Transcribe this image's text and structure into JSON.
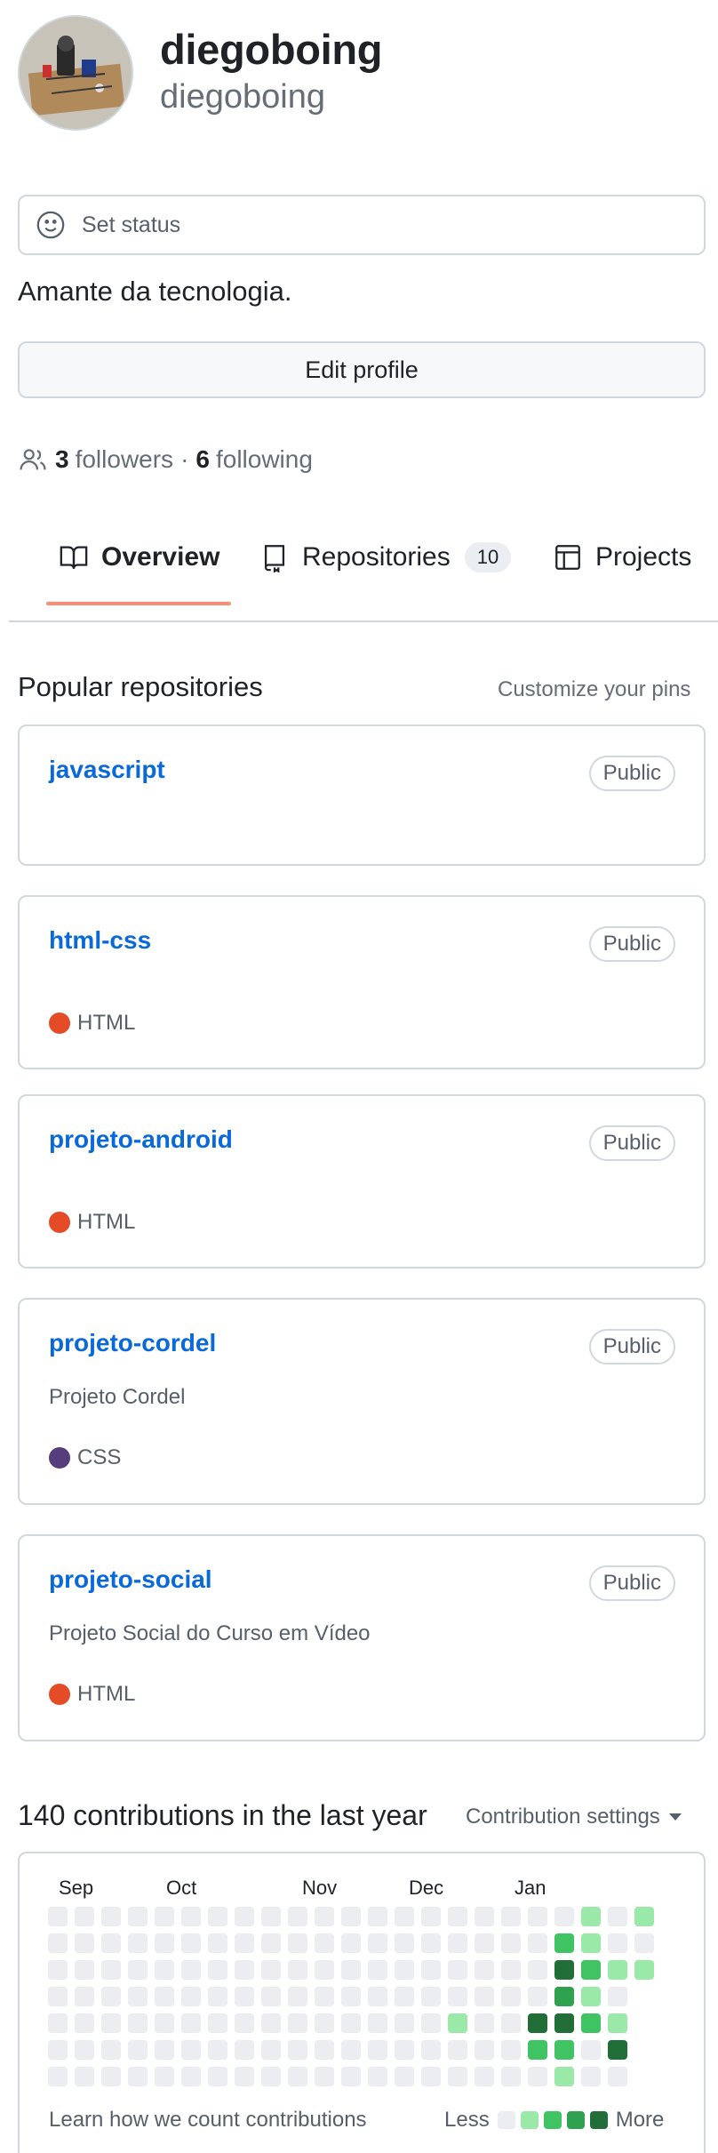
{
  "profile": {
    "display_name": "diegoboing",
    "login": "diegoboing",
    "avatar_alt": "avatar"
  },
  "status": {
    "placeholder": "Set status",
    "icon": "smiley-icon"
  },
  "bio": "Amante da tecnologia.",
  "edit_profile_label": "Edit profile",
  "social": {
    "followers_count": "3",
    "followers_label": "followers",
    "separator": "·",
    "following_count": "6",
    "following_label": "following"
  },
  "tabs": [
    {
      "label": "Overview",
      "icon": "book-icon",
      "selected": true
    },
    {
      "label": "Repositories",
      "icon": "repo-icon",
      "counter": "10"
    },
    {
      "label": "Projects",
      "icon": "table-icon"
    }
  ],
  "popular": {
    "title": "Popular repositories",
    "customize_label": "Customize your pins",
    "repos": [
      {
        "name": "javascript",
        "visibility": "Public",
        "description": "",
        "language": ""
      },
      {
        "name": "html-css",
        "visibility": "Public",
        "description": "",
        "language": "HTML"
      },
      {
        "name": "projeto-android",
        "visibility": "Public",
        "description": "",
        "language": "HTML"
      },
      {
        "name": "projeto-cordel",
        "visibility": "Public",
        "description": "Projeto Cordel",
        "language": "CSS"
      },
      {
        "name": "projeto-social",
        "visibility": "Public",
        "description": "Projeto Social do Curso em Vídeo",
        "language": "HTML"
      }
    ]
  },
  "colors": {
    "link": "#0969da",
    "tab_underline": "#fd8c73",
    "lang_html": "#e34c26",
    "lang_css": "#563d7c",
    "contrib_levels": [
      "#ebedf0",
      "#9be9a8",
      "#40c463",
      "#30a14e",
      "#216e39"
    ]
  },
  "contributions": {
    "title": "140 contributions in the last year",
    "settings_label": "Contribution settings",
    "months": [
      "Sep",
      "Oct",
      "Nov",
      "Dec",
      "Jan"
    ],
    "learn_label": "Learn how we count contributions",
    "legend_less": "Less",
    "legend_more": "More",
    "weeks": [
      [
        0,
        0,
        0,
        0,
        0,
        0,
        0
      ],
      [
        0,
        0,
        0,
        0,
        0,
        0,
        0
      ],
      [
        0,
        0,
        0,
        0,
        0,
        0,
        0
      ],
      [
        0,
        0,
        0,
        0,
        0,
        0,
        0
      ],
      [
        0,
        0,
        0,
        0,
        0,
        0,
        0
      ],
      [
        0,
        0,
        0,
        0,
        0,
        0,
        0
      ],
      [
        0,
        0,
        0,
        0,
        0,
        0,
        0
      ],
      [
        0,
        0,
        0,
        0,
        0,
        0,
        0
      ],
      [
        0,
        0,
        0,
        0,
        0,
        0,
        0
      ],
      [
        0,
        0,
        0,
        0,
        0,
        0,
        0
      ],
      [
        0,
        0,
        0,
        0,
        0,
        0,
        0
      ],
      [
        0,
        0,
        0,
        0,
        0,
        0,
        0
      ],
      [
        0,
        0,
        0,
        0,
        0,
        0,
        0
      ],
      [
        0,
        0,
        0,
        0,
        0,
        0,
        0
      ],
      [
        0,
        0,
        0,
        0,
        0,
        0,
        0
      ],
      [
        0,
        0,
        0,
        0,
        1,
        0,
        0
      ],
      [
        0,
        0,
        0,
        0,
        0,
        0,
        0
      ],
      [
        0,
        0,
        0,
        0,
        0,
        0,
        0
      ],
      [
        0,
        0,
        0,
        0,
        4,
        2,
        0
      ],
      [
        0,
        2,
        4,
        3,
        4,
        2,
        1
      ],
      [
        1,
        1,
        2,
        1,
        2,
        0,
        0
      ],
      [
        0,
        0,
        1,
        0,
        1,
        4,
        0
      ],
      [
        1,
        0,
        1
      ]
    ]
  }
}
